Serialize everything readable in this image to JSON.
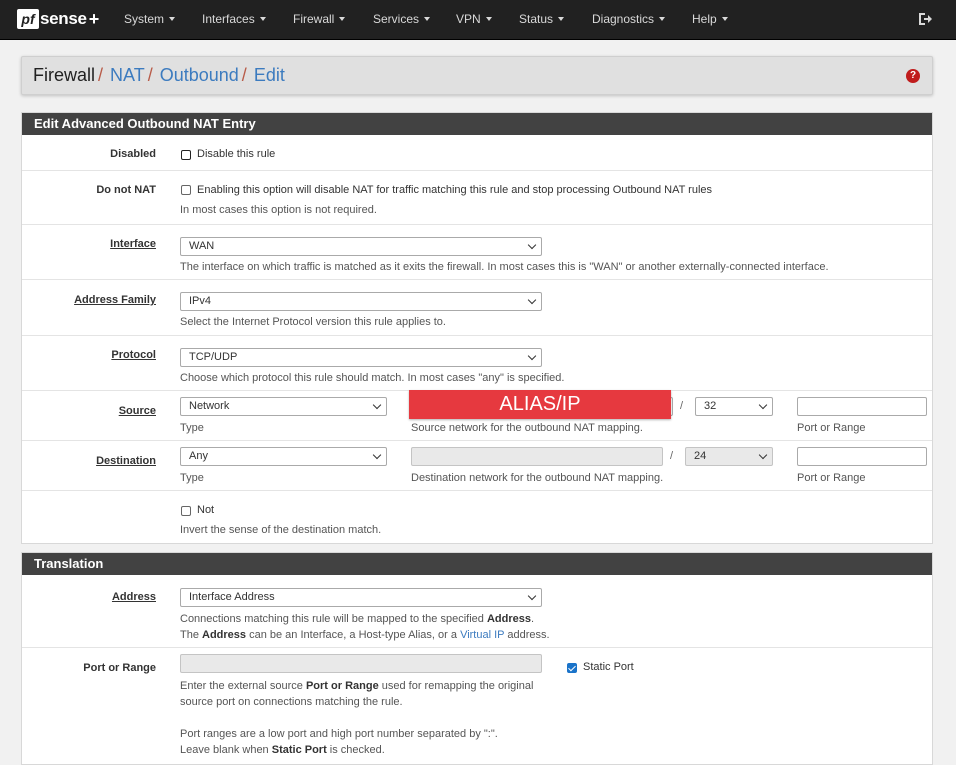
{
  "nav": {
    "brand": "sense",
    "brand_prefix": "pf",
    "brand_plus": "+",
    "items": [
      "System",
      "Interfaces",
      "Firewall",
      "Services",
      "VPN",
      "Status",
      "Diagnostics",
      "Help"
    ]
  },
  "breadcrumb": {
    "items": [
      "Firewall",
      "NAT",
      "Outbound",
      "Edit"
    ],
    "help_icon": "question-circle-icon"
  },
  "edit_panel": {
    "title": "Edit Advanced Outbound NAT Entry",
    "disabled": {
      "label": "Disabled",
      "checkbox_label": "Disable this rule",
      "checked": false
    },
    "donotnat": {
      "label": "Do not NAT",
      "checkbox_label": "Enabling this option will disable NAT for traffic matching this rule and stop processing Outbound NAT rules",
      "help": "In most cases this option is not required.",
      "checked": false
    },
    "interface": {
      "label": "Interface",
      "value": "WAN",
      "help": "The interface on which traffic is matched as it exits the firewall. In most cases this is \"WAN\" or another externally-connected interface."
    },
    "address_family": {
      "label": "Address Family",
      "value": "IPv4",
      "help": "Select the Internet Protocol version this rule applies to."
    },
    "protocol": {
      "label": "Protocol",
      "value": "TCP/UDP",
      "help": "Choose which protocol this rule should match. In most cases \"any\" is specified."
    },
    "source": {
      "label": "Source",
      "type_value": "Network",
      "type_help": "Type",
      "network_help": "Source network for the outbound NAT mapping.",
      "mask_sep": "/",
      "mask": "32",
      "port_help": "Port or Range",
      "overlay_tag": "ALIAS/IP"
    },
    "destination": {
      "label": "Destination",
      "type_value": "Any",
      "type_help": "Type",
      "network_help": "Destination network for the outbound NAT mapping.",
      "mask_sep": "/",
      "mask": "24",
      "port_help": "Port or Range"
    },
    "not": {
      "checkbox_label": "Not",
      "help": "Invert the sense of the destination match.",
      "checked": false
    }
  },
  "translation_panel": {
    "title": "Translation",
    "address": {
      "label": "Address",
      "value": "Interface Address",
      "help1_pre": "Connections matching this rule will be mapped to the specified ",
      "help1_bold": "Address",
      "help1_post": ".",
      "help2_pre": "The ",
      "help2_bold": "Address",
      "help2_mid": " can be an Interface, a Host-type Alias, or a ",
      "help2_link": "Virtual IP",
      "help2_post": " address."
    },
    "port": {
      "label": "Port or Range",
      "static_port_label": "Static Port",
      "static_port_checked": true,
      "help1_pre": "Enter the external source ",
      "help1_bold": "Port or Range",
      "help1_post": " used for remapping the original",
      "help2": "source port on connections matching the rule.",
      "help3": "Port ranges are a low port and high port number separated by \":\".",
      "help4_pre": "Leave blank when ",
      "help4_bold": "Static Port",
      "help4_post": " is checked."
    }
  }
}
